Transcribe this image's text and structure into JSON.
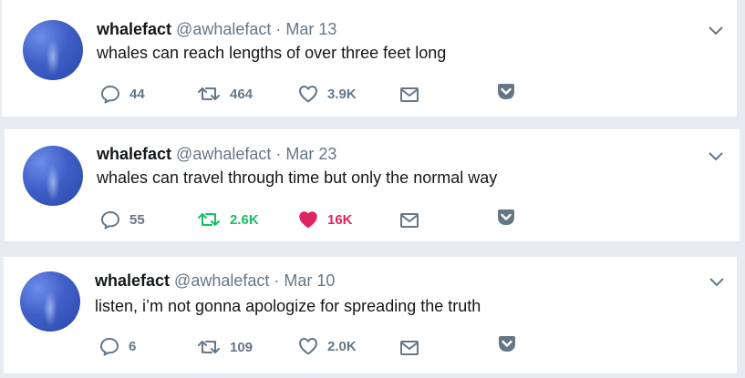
{
  "tweets": [
    {
      "name": "whalefact",
      "handle": "@awhalefact",
      "separator": "·",
      "date": "Mar 13",
      "text": "whales can reach lengths of over three feet long",
      "replies": "44",
      "retweets": "464",
      "likes": "3.9K",
      "retweeted": false,
      "liked": false
    },
    {
      "name": "whalefact",
      "handle": "@awhalefact",
      "separator": "·",
      "date": "Mar 23",
      "text": "whales can travel through time but only the normal way",
      "replies": "55",
      "retweets": "2.6K",
      "likes": "16K",
      "retweeted": true,
      "liked": true
    },
    {
      "name": "whalefact",
      "handle": "@awhalefact",
      "separator": "·",
      "date": "Mar 10",
      "text": "listen, i’m not gonna apologize for spreading the truth",
      "replies": "6",
      "retweets": "109",
      "likes": "2.0K",
      "retweeted": false,
      "liked": false
    }
  ],
  "icons": {
    "reply": "reply-icon",
    "retweet": "retweet-icon",
    "like": "heart-icon",
    "message": "envelope-icon",
    "save": "pocket-icon",
    "more": "chevron-down-icon"
  },
  "colors": {
    "icon_gray": "#657786",
    "retweet_green": "#17bf63",
    "like_red": "#e0245e",
    "text": "#14171a",
    "background": "#e6ecf0"
  }
}
